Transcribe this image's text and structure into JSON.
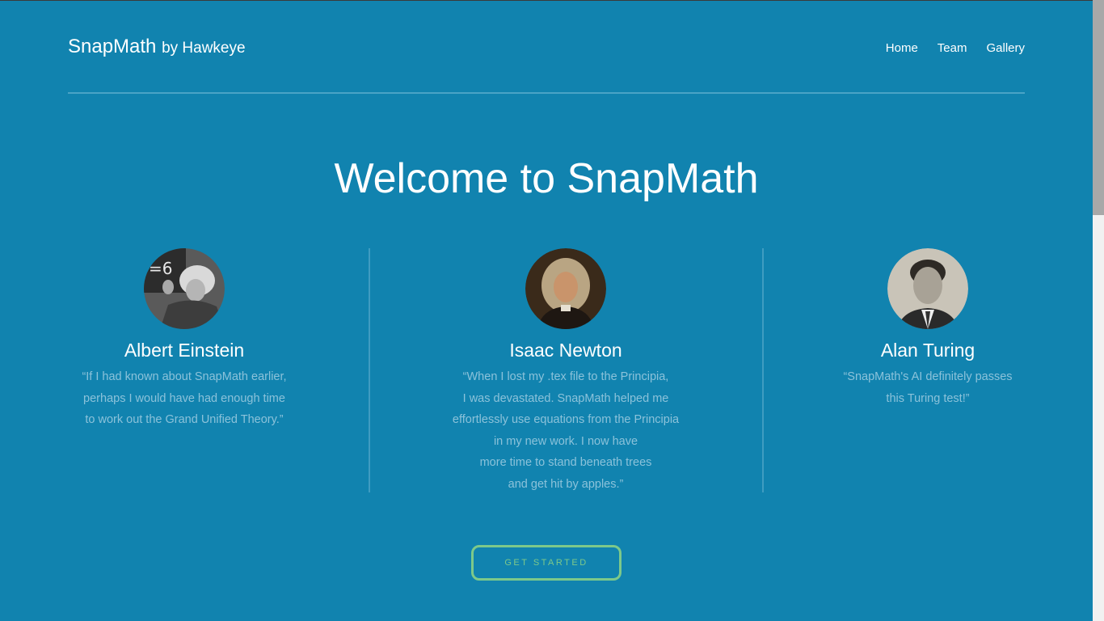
{
  "header": {
    "brand_name": "SnapMath",
    "brand_by": "by Hawkeye",
    "nav": [
      "Home",
      "Team",
      "Gallery"
    ]
  },
  "hero": {
    "title": "Welcome to SnapMath"
  },
  "people": [
    {
      "name": "Albert Einstein",
      "avatar_icon": "einstein-portrait",
      "quote_lines": [
        "“If I had known about SnapMath earlier,",
        "perhaps I would have had enough time",
        "to work out the Grand Unified Theory.”"
      ]
    },
    {
      "name": "Isaac Newton",
      "avatar_icon": "newton-portrait",
      "quote_lines": [
        "“When I lost my .tex file to the Principia,",
        "I was devastated. SnapMath helped me",
        "effortlessly use equations from the Principia",
        "in my new work. I now have",
        "more time to stand beneath trees",
        "and get hit by apples.”"
      ]
    },
    {
      "name": "Alan Turing",
      "avatar_icon": "turing-portrait",
      "quote_lines": [
        "“SnapMath's AI definitely passes",
        "this Turing test!”"
      ]
    }
  ],
  "cta": {
    "label": "GET STARTED"
  },
  "colors": {
    "background": "#1183af",
    "quote_text": "#8bc2da",
    "cta_accent": "#7dc98a"
  }
}
